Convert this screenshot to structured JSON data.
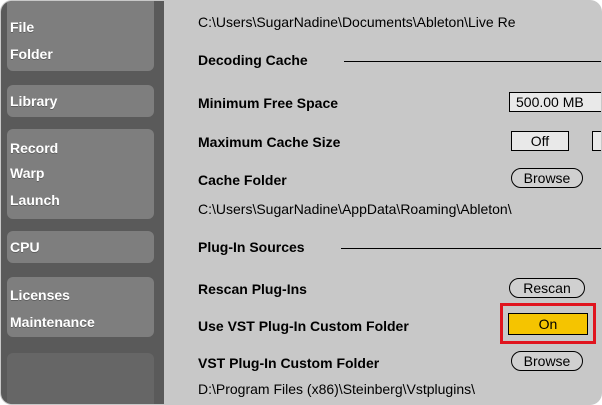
{
  "sidebar": {
    "items": [
      {
        "label": "File",
        "active": false
      },
      {
        "label": "Folder",
        "active": false
      },
      {
        "label": "Library",
        "active": false
      },
      {
        "label": "Record",
        "active": false
      },
      {
        "label": "Warp",
        "active": false
      },
      {
        "label": "Launch",
        "active": false
      },
      {
        "label": "CPU",
        "active": false
      },
      {
        "label": "Licenses",
        "active": false
      },
      {
        "label": "Maintenance",
        "active": false
      }
    ]
  },
  "main": {
    "top_path": "C:\\Users\\SugarNadine\\Documents\\Ableton\\Live Re",
    "decoding_cache": {
      "section_title": "Decoding Cache",
      "min_free_space_label": "Minimum Free Space",
      "min_free_space_value": "500.00 MB",
      "max_cache_size_label": "Maximum Cache Size",
      "max_cache_size_value": "Off",
      "cache_folder_label": "Cache Folder",
      "cache_folder_button": "Browse",
      "cache_folder_path": "C:\\Users\\SugarNadine\\AppData\\Roaming\\Ableton\\"
    },
    "plugin_sources": {
      "section_title": "Plug-In Sources",
      "rescan_label": "Rescan Plug-Ins",
      "rescan_button": "Rescan",
      "vst_custom_folder_toggle_label": "Use VST Plug-In Custom Folder",
      "vst_custom_folder_toggle_value": "On",
      "vst_custom_folder_label": "VST Plug-In Custom Folder",
      "vst_custom_folder_button": "Browse",
      "vst_custom_folder_path": "D:\\Program Files (x86)\\Steinberg\\Vstplugins\\"
    }
  },
  "colors": {
    "sidebar_bg": "#5a5a5a",
    "sidebar_group_bg": "#7e7e7e",
    "panel_bg": "#c8c8c8",
    "toggle_on": "#f5c400",
    "highlight": "#e0141e"
  }
}
